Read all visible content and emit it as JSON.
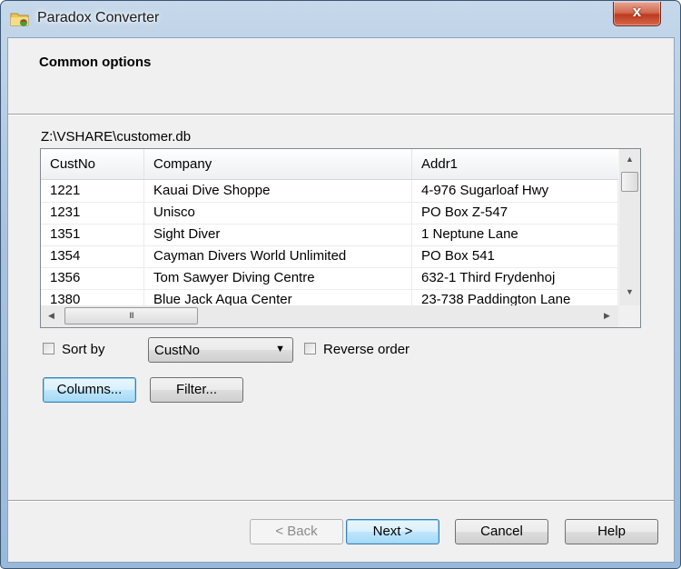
{
  "window": {
    "title": "Paradox Converter",
    "icon": "folder-database-icon",
    "close_label": "x"
  },
  "page": {
    "title": "Common options",
    "file_path": "Z:\\VSHARE\\customer.db"
  },
  "table": {
    "columns": [
      "CustNo",
      "Company",
      "Addr1"
    ],
    "rows": [
      [
        "1221",
        "Kauai Dive Shoppe",
        "4-976 Sugarloaf Hwy"
      ],
      [
        "1231",
        "Unisco",
        "PO Box Z-547"
      ],
      [
        "1351",
        "Sight Diver",
        "1 Neptune Lane"
      ],
      [
        "1354",
        "Cayman Divers World Unlimited",
        "PO Box 541"
      ],
      [
        "1356",
        "Tom Sawyer Diving Centre",
        "632-1 Third Frydenhoj"
      ],
      [
        "1380",
        "Blue Jack Aqua Center",
        "23-738 Paddington Lane"
      ]
    ],
    "hscroll_thumb_glyph": "III"
  },
  "options": {
    "sort_by_label": "Sort by",
    "sort_by_checked": false,
    "sort_field": "CustNo",
    "reverse_label": "Reverse order",
    "reverse_checked": false,
    "columns_button": "Columns...",
    "filter_button": "Filter..."
  },
  "footer": {
    "back": "< Back",
    "next": "Next >",
    "cancel": "Cancel",
    "help": "Help"
  }
}
